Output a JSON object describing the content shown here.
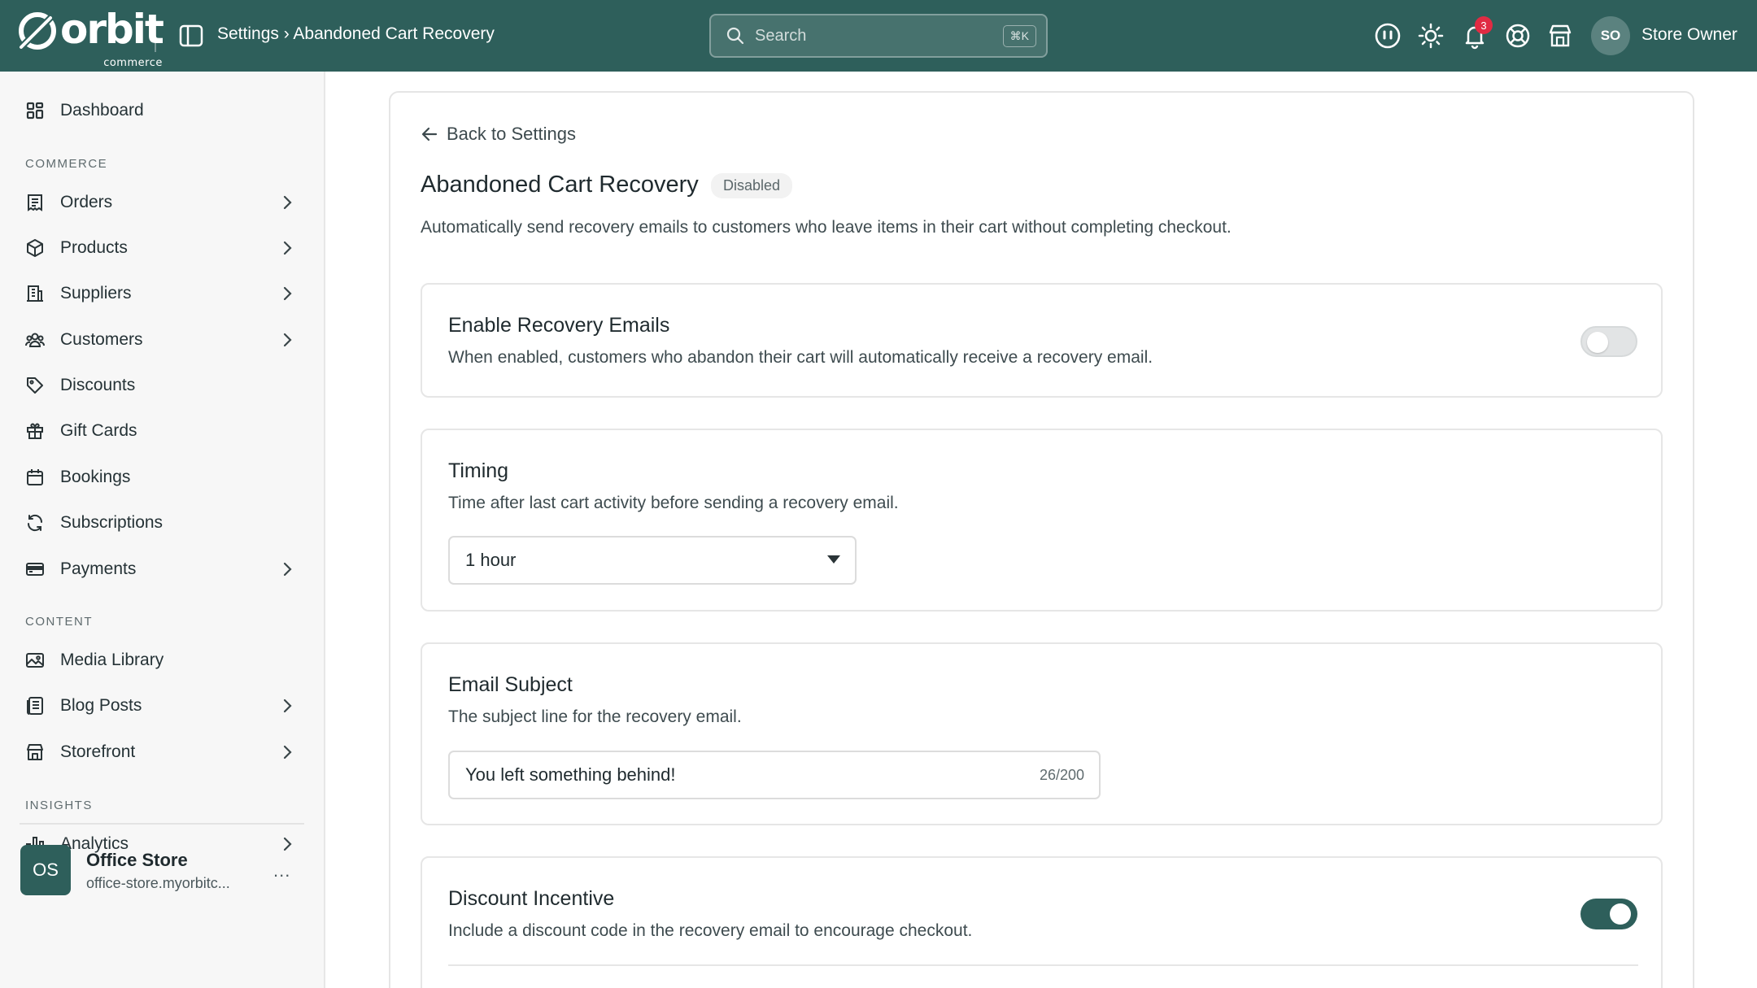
{
  "header": {
    "logo_text": "orbit",
    "logo_sub": "commerce",
    "breadcrumb": "Settings › Abandoned Cart Recovery",
    "search_placeholder": "Search",
    "search_shortcut": "⌘K",
    "notification_count": "3",
    "user_initials": "SO",
    "user_name": "Store Owner"
  },
  "sidebar": {
    "dashboard": "Dashboard",
    "sections": {
      "commerce": "COMMERCE",
      "content": "CONTENT",
      "insights": "INSIGHTS"
    },
    "commerce_items": [
      {
        "label": "Orders",
        "icon": "receipt-icon"
      },
      {
        "label": "Products",
        "icon": "box-icon"
      },
      {
        "label": "Suppliers",
        "icon": "building-icon"
      },
      {
        "label": "Customers",
        "icon": "users-icon"
      },
      {
        "label": "Discounts",
        "icon": "tag-icon"
      },
      {
        "label": "Gift Cards",
        "icon": "gift-icon"
      },
      {
        "label": "Bookings",
        "icon": "calendar-icon"
      },
      {
        "label": "Subscriptions",
        "icon": "refresh-icon"
      },
      {
        "label": "Payments",
        "icon": "credit-card-icon"
      }
    ],
    "content_items": [
      {
        "label": "Media Library",
        "icon": "image-icon"
      },
      {
        "label": "Blog Posts",
        "icon": "document-icon"
      },
      {
        "label": "Storefront",
        "icon": "store-icon"
      }
    ],
    "insights_items": [
      {
        "label": "Analytics",
        "icon": "bar-chart-icon"
      }
    ],
    "store": {
      "initials": "OS",
      "name": "Office Store",
      "url": "office-store.myorbitc...",
      "more": "..."
    }
  },
  "main": {
    "back_label": "Back to Settings",
    "title": "Abandoned Cart Recovery",
    "status": "Disabled",
    "description": "Automatically send recovery emails to customers who leave items in their cart without completing checkout.",
    "enable": {
      "title": "Enable Recovery Emails",
      "description": "When enabled, customers who abandon their cart will automatically receive a recovery email.",
      "enabled": false
    },
    "timing": {
      "title": "Timing",
      "description": "Time after last cart activity before sending a recovery email.",
      "selected": "1 hour"
    },
    "subject": {
      "title": "Email Subject",
      "description": "The subject line for the recovery email.",
      "value": "You left something behind!",
      "counter": "26/200"
    },
    "discount": {
      "title": "Discount Incentive",
      "description": "Include a discount code in the recovery email to encourage checkout.",
      "enabled": true
    }
  },
  "colors": {
    "brand": "#2e5f5b",
    "badge": "#e02b43"
  }
}
